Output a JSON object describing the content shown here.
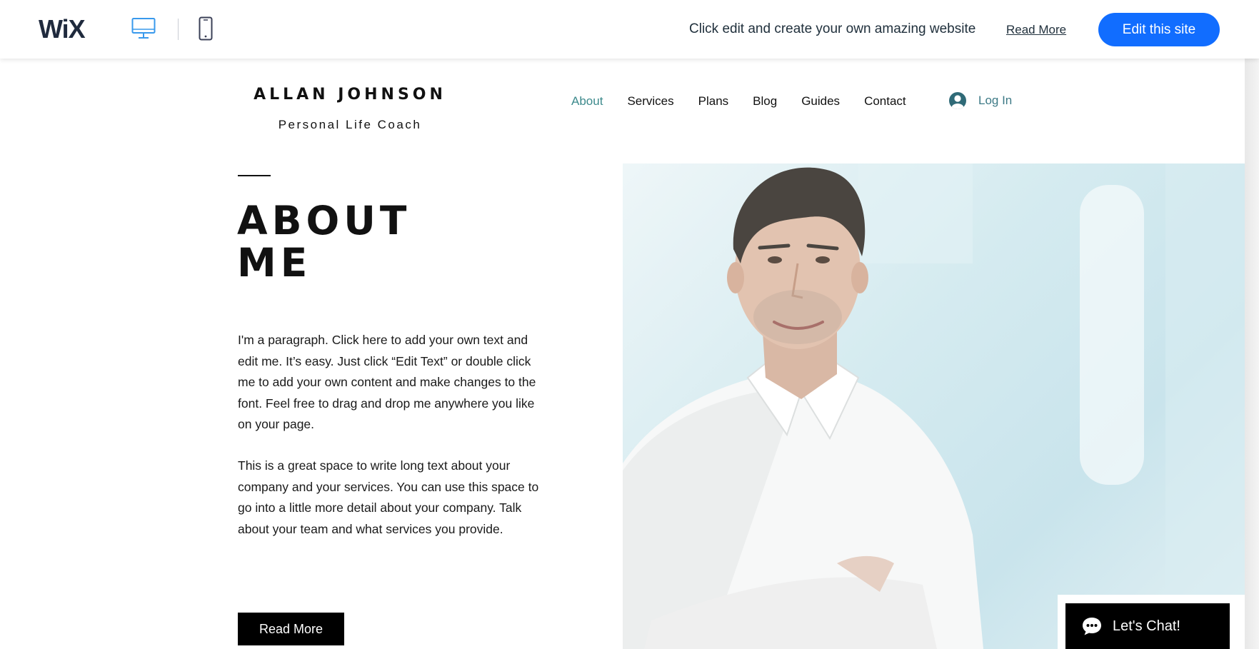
{
  "wix_bar": {
    "logo": "WiX",
    "message": "Click edit and create your own amazing website",
    "read_more": "Read More",
    "cta": "Edit this site"
  },
  "site": {
    "title": "ALLAN JOHNSON",
    "subtitle": "Personal Life Coach",
    "nav": [
      {
        "label": "About",
        "active": true
      },
      {
        "label": "Services",
        "active": false
      },
      {
        "label": "Plans",
        "active": false
      },
      {
        "label": "Blog",
        "active": false
      },
      {
        "label": "Guides",
        "active": false
      },
      {
        "label": "Contact",
        "active": false
      }
    ],
    "login": "Log In"
  },
  "about": {
    "heading_line1": "ABOUT",
    "heading_line2": "ME",
    "paragraph1": "I'm a paragraph. Click here to add your own text and edit me. It’s easy. Just click “Edit Text” or double click me to add your own content and make changes to the font. Feel free to drag and drop me anywhere you like on your page.",
    "paragraph2": "This is a great space to write long text about your company and your services. You can use this space to go into a little more detail about your company. Talk about your team and what services you provide.",
    "button": "Read More"
  },
  "chat": {
    "label": "Let's Chat!"
  },
  "colors": {
    "wix_blue": "#116dff",
    "nav_active": "#3d8a8c",
    "login": "#3d7a86",
    "dark": "#000000"
  },
  "icons": {
    "desktop": "desktop-icon",
    "mobile": "mobile-icon",
    "user": "user-avatar-icon",
    "chat": "chat-bubble-icon"
  }
}
